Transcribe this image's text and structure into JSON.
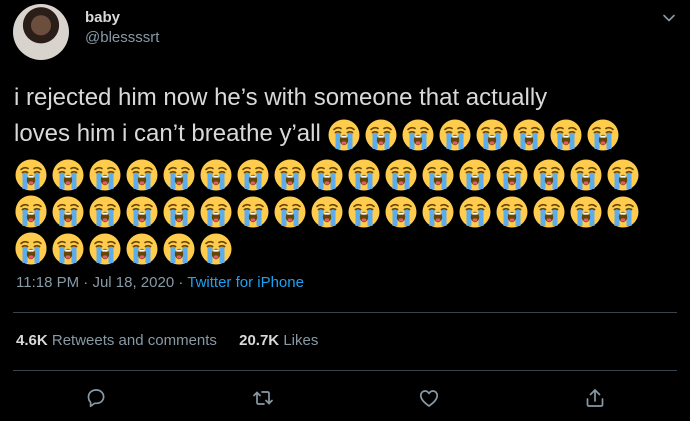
{
  "user": {
    "display_name": "baby",
    "handle": "@blessssrt"
  },
  "tweet": {
    "text_line1": "i rejected him now he’s with someone that actually",
    "text_line2": "loves him i can’t breathe y’all",
    "emoji": "loudly-crying-face",
    "emoji_count_line2": 8,
    "emoji_count_row2": 18,
    "emoji_count_row3": 18,
    "emoji_count_row4": 6
  },
  "meta": {
    "time": "11:18 PM",
    "sep1": " · ",
    "date": "Jul 18, 2020",
    "sep2": " · ",
    "source": "Twitter for iPhone"
  },
  "stats": {
    "retweets_count": "4.6K",
    "retweets_label": "Retweets and comments",
    "likes_count": "20.7K",
    "likes_label": "Likes"
  },
  "colors": {
    "background": "#000000",
    "text": "#d9d9d9",
    "muted": "#8899a6",
    "link": "#1da1f2",
    "divider": "#38444d"
  },
  "icons": [
    "chevron-down-icon",
    "reply-icon",
    "retweet-icon",
    "like-icon",
    "share-icon"
  ]
}
